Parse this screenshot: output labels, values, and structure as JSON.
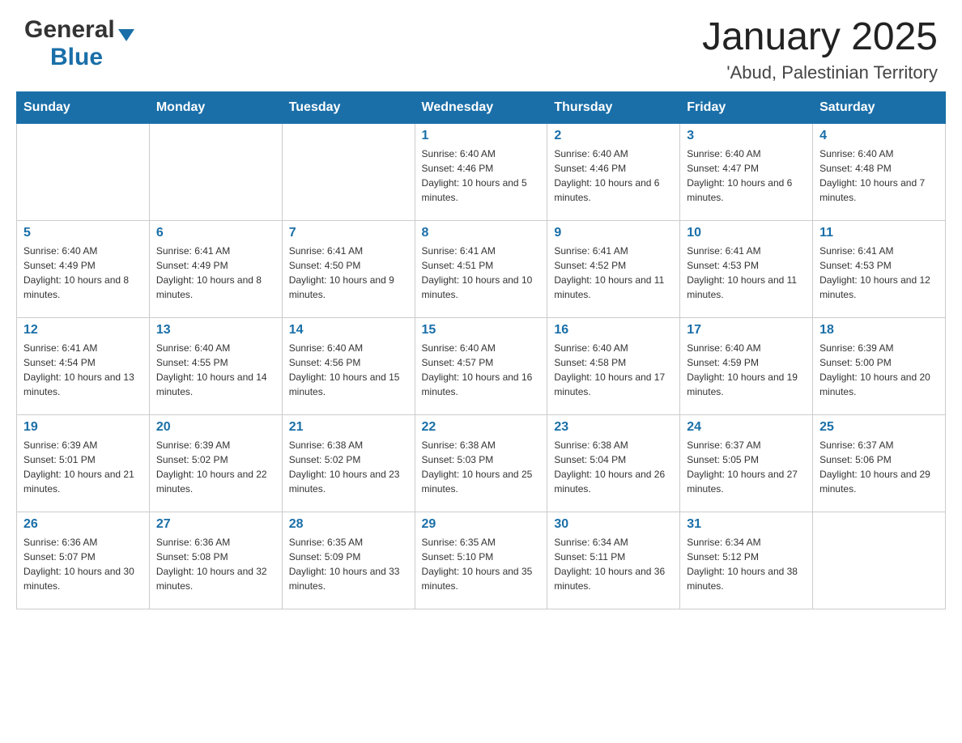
{
  "header": {
    "logo_general": "General",
    "logo_blue": "Blue",
    "month": "January 2025",
    "location": "'Abud, Palestinian Territory"
  },
  "days_of_week": [
    "Sunday",
    "Monday",
    "Tuesday",
    "Wednesday",
    "Thursday",
    "Friday",
    "Saturday"
  ],
  "weeks": [
    [
      {
        "day": "",
        "info": ""
      },
      {
        "day": "",
        "info": ""
      },
      {
        "day": "",
        "info": ""
      },
      {
        "day": "1",
        "info": "Sunrise: 6:40 AM\nSunset: 4:46 PM\nDaylight: 10 hours and 5 minutes."
      },
      {
        "day": "2",
        "info": "Sunrise: 6:40 AM\nSunset: 4:46 PM\nDaylight: 10 hours and 6 minutes."
      },
      {
        "day": "3",
        "info": "Sunrise: 6:40 AM\nSunset: 4:47 PM\nDaylight: 10 hours and 6 minutes."
      },
      {
        "day": "4",
        "info": "Sunrise: 6:40 AM\nSunset: 4:48 PM\nDaylight: 10 hours and 7 minutes."
      }
    ],
    [
      {
        "day": "5",
        "info": "Sunrise: 6:40 AM\nSunset: 4:49 PM\nDaylight: 10 hours and 8 minutes."
      },
      {
        "day": "6",
        "info": "Sunrise: 6:41 AM\nSunset: 4:49 PM\nDaylight: 10 hours and 8 minutes."
      },
      {
        "day": "7",
        "info": "Sunrise: 6:41 AM\nSunset: 4:50 PM\nDaylight: 10 hours and 9 minutes."
      },
      {
        "day": "8",
        "info": "Sunrise: 6:41 AM\nSunset: 4:51 PM\nDaylight: 10 hours and 10 minutes."
      },
      {
        "day": "9",
        "info": "Sunrise: 6:41 AM\nSunset: 4:52 PM\nDaylight: 10 hours and 11 minutes."
      },
      {
        "day": "10",
        "info": "Sunrise: 6:41 AM\nSunset: 4:53 PM\nDaylight: 10 hours and 11 minutes."
      },
      {
        "day": "11",
        "info": "Sunrise: 6:41 AM\nSunset: 4:53 PM\nDaylight: 10 hours and 12 minutes."
      }
    ],
    [
      {
        "day": "12",
        "info": "Sunrise: 6:41 AM\nSunset: 4:54 PM\nDaylight: 10 hours and 13 minutes."
      },
      {
        "day": "13",
        "info": "Sunrise: 6:40 AM\nSunset: 4:55 PM\nDaylight: 10 hours and 14 minutes."
      },
      {
        "day": "14",
        "info": "Sunrise: 6:40 AM\nSunset: 4:56 PM\nDaylight: 10 hours and 15 minutes."
      },
      {
        "day": "15",
        "info": "Sunrise: 6:40 AM\nSunset: 4:57 PM\nDaylight: 10 hours and 16 minutes."
      },
      {
        "day": "16",
        "info": "Sunrise: 6:40 AM\nSunset: 4:58 PM\nDaylight: 10 hours and 17 minutes."
      },
      {
        "day": "17",
        "info": "Sunrise: 6:40 AM\nSunset: 4:59 PM\nDaylight: 10 hours and 19 minutes."
      },
      {
        "day": "18",
        "info": "Sunrise: 6:39 AM\nSunset: 5:00 PM\nDaylight: 10 hours and 20 minutes."
      }
    ],
    [
      {
        "day": "19",
        "info": "Sunrise: 6:39 AM\nSunset: 5:01 PM\nDaylight: 10 hours and 21 minutes."
      },
      {
        "day": "20",
        "info": "Sunrise: 6:39 AM\nSunset: 5:02 PM\nDaylight: 10 hours and 22 minutes."
      },
      {
        "day": "21",
        "info": "Sunrise: 6:38 AM\nSunset: 5:02 PM\nDaylight: 10 hours and 23 minutes."
      },
      {
        "day": "22",
        "info": "Sunrise: 6:38 AM\nSunset: 5:03 PM\nDaylight: 10 hours and 25 minutes."
      },
      {
        "day": "23",
        "info": "Sunrise: 6:38 AM\nSunset: 5:04 PM\nDaylight: 10 hours and 26 minutes."
      },
      {
        "day": "24",
        "info": "Sunrise: 6:37 AM\nSunset: 5:05 PM\nDaylight: 10 hours and 27 minutes."
      },
      {
        "day": "25",
        "info": "Sunrise: 6:37 AM\nSunset: 5:06 PM\nDaylight: 10 hours and 29 minutes."
      }
    ],
    [
      {
        "day": "26",
        "info": "Sunrise: 6:36 AM\nSunset: 5:07 PM\nDaylight: 10 hours and 30 minutes."
      },
      {
        "day": "27",
        "info": "Sunrise: 6:36 AM\nSunset: 5:08 PM\nDaylight: 10 hours and 32 minutes."
      },
      {
        "day": "28",
        "info": "Sunrise: 6:35 AM\nSunset: 5:09 PM\nDaylight: 10 hours and 33 minutes."
      },
      {
        "day": "29",
        "info": "Sunrise: 6:35 AM\nSunset: 5:10 PM\nDaylight: 10 hours and 35 minutes."
      },
      {
        "day": "30",
        "info": "Sunrise: 6:34 AM\nSunset: 5:11 PM\nDaylight: 10 hours and 36 minutes."
      },
      {
        "day": "31",
        "info": "Sunrise: 6:34 AM\nSunset: 5:12 PM\nDaylight: 10 hours and 38 minutes."
      },
      {
        "day": "",
        "info": ""
      }
    ]
  ]
}
